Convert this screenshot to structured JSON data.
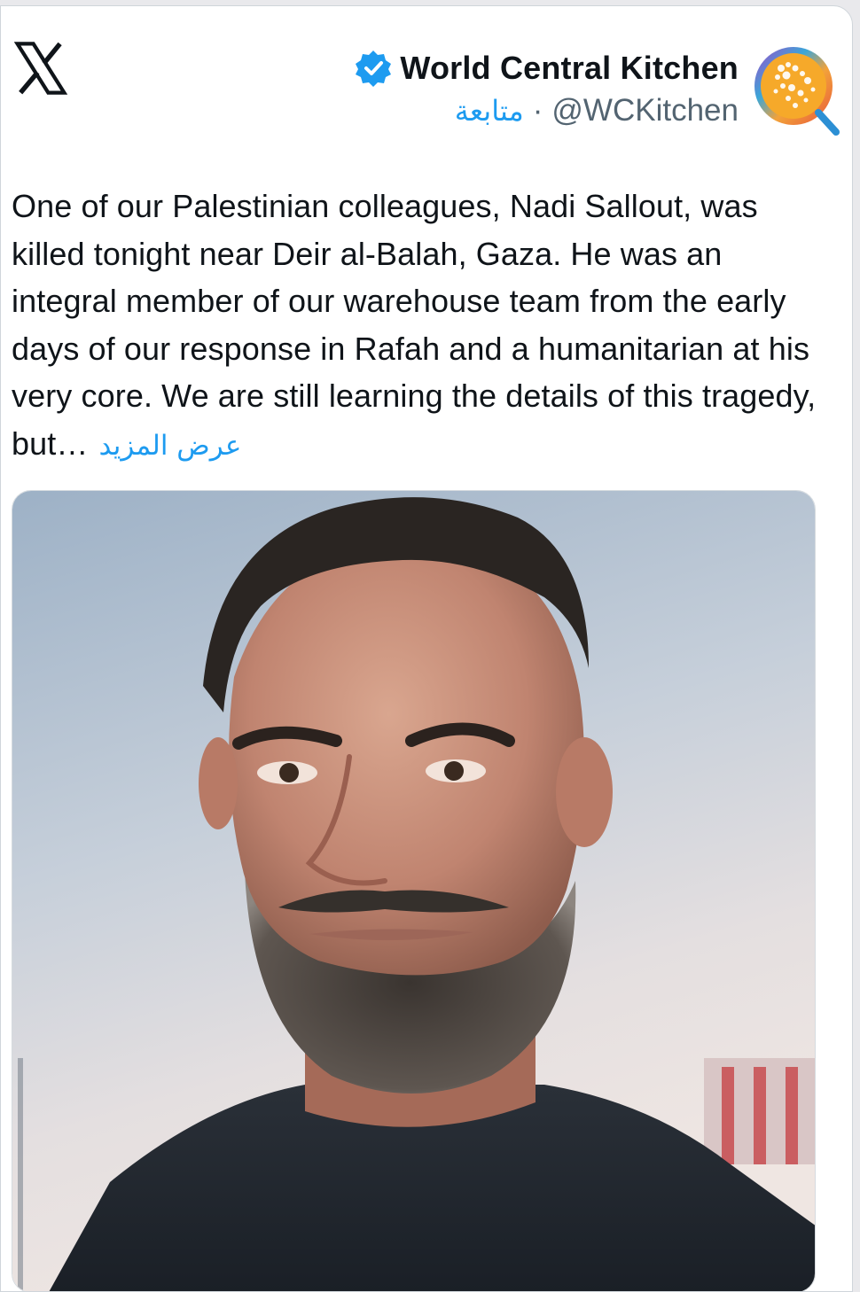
{
  "tweet": {
    "author": {
      "display_name": "World Central Kitchen",
      "handle": "@WCKitchen",
      "follow_label": "متابعة",
      "separator": "·",
      "verified": true,
      "avatar_icon": "wck-globe-logo-icon"
    },
    "text": "One of our Palestinian colleagues, Nadi Sallout, was killed tonight near Deir al-Balah, Gaza. He was an integral member of our warehouse team from the early days of our response in Rafah and a humanitarian at his very core. We are still learning the details of this tragedy, but…",
    "show_more_label": "عرض المزيد",
    "media": {
      "type": "photo",
      "subject": "portrait-photo"
    }
  },
  "platform": {
    "logo_icon": "x-logo-icon"
  },
  "colors": {
    "accent": "#1d9bf0",
    "text": "#0f1419",
    "secondary_text": "#536471"
  }
}
